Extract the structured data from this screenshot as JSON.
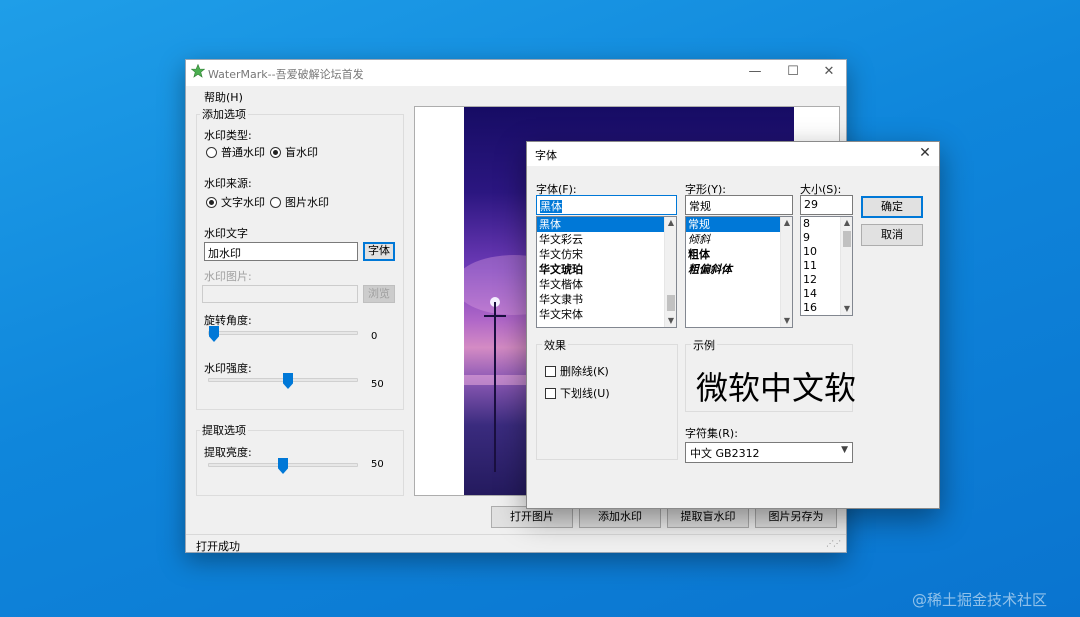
{
  "window": {
    "title": "WaterMark--吾爱破解论坛首发",
    "minimize": "—",
    "maximize": "☐",
    "close": "✕"
  },
  "menu": {
    "help": "帮助(H)"
  },
  "add_options": {
    "group_title": "添加选项",
    "type_label": "水印类型:",
    "type_normal": "普通水印",
    "type_blind": "盲水印",
    "type_selected": "盲水印",
    "source_label": "水印来源:",
    "source_text": "文字水印",
    "source_image": "图片水印",
    "source_selected": "文字水印",
    "text_label": "水印文字",
    "text_value": "加水印",
    "font_button": "字体",
    "image_label": "水印图片:",
    "image_value": "",
    "browse_button": "浏览",
    "rotation_label": "旋转角度:",
    "rotation_value": "0",
    "strength_label": "水印强度:",
    "strength_value": "50"
  },
  "extract_options": {
    "group_title": "提取选项",
    "brightness_label": "提取亮度:",
    "brightness_value": "50"
  },
  "actions": {
    "open_image": "打开图片",
    "add_watermark": "添加水印",
    "extract_blind": "提取盲水印",
    "save_as": "图片另存为"
  },
  "status": {
    "text": "打开成功",
    "grip": "⋰⋰"
  },
  "font_dialog": {
    "title": "字体",
    "close": "✕",
    "font_label": "字体(F):",
    "font_value": "黑体",
    "font_list": [
      "黑体",
      "华文彩云",
      "华文仿宋",
      "华文琥珀",
      "华文楷体",
      "华文隶书",
      "华文宋体"
    ],
    "style_label": "字形(Y):",
    "style_value": "常规",
    "style_list": [
      "常规",
      "倾斜",
      "粗体",
      "粗偏斜体"
    ],
    "size_label": "大小(S):",
    "size_value": "29",
    "size_list": [
      "8",
      "9",
      "10",
      "11",
      "12",
      "14",
      "16"
    ],
    "ok_button": "确定",
    "cancel_button": "取消",
    "effects_title": "效果",
    "strikeout_label": "删除线(K)",
    "underline_label": "下划线(U)",
    "sample_title": "示例",
    "sample_text": "微软中文软",
    "charset_label": "字符集(R):",
    "charset_value": "中文 GB2312"
  },
  "credit": "@稀土掘金技术社区",
  "colors": {
    "accent": "#0078d7",
    "desktop": "#0f86db"
  }
}
